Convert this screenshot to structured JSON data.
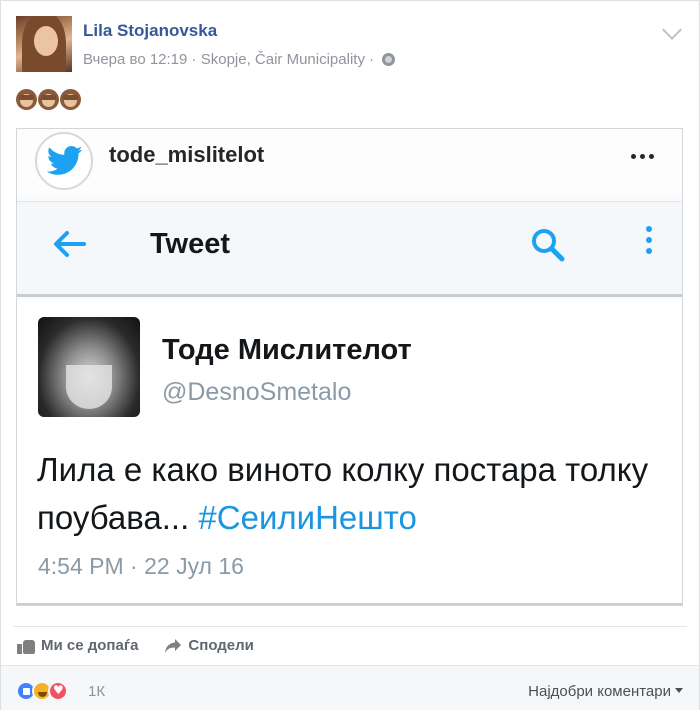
{
  "post": {
    "author": "Lila Stojanovska",
    "timestamp": "Вчера во 12:19",
    "location": "Skopje, Čair Municipality",
    "separator": " · "
  },
  "embed": {
    "instagram_user": "tode_mislitelot",
    "toolbar_title": "Tweet",
    "tweet": {
      "name": "Тоде Мислителот",
      "handle": "@DesnoSmetalo",
      "text": "Лила е како виното колку постара толку поубава...",
      "hashtag": "#СеилиНешто",
      "time": "4:54 PM · 22 Јул 16"
    }
  },
  "actions": {
    "like_label": "Ми се допаѓа",
    "share_label": "Сподели"
  },
  "reactions": {
    "count": "1К",
    "sort_label": "Најдобри коментари"
  },
  "colors": {
    "facebook_link": "#365899",
    "twitter_blue": "#1da1f2",
    "hashtag": "#1b95e0"
  },
  "icons": [
    "monkey-icon",
    "twitter-bird-icon",
    "more-icon",
    "back-arrow-icon",
    "search-icon",
    "kebab-icon",
    "like-icon",
    "share-icon",
    "globe-icon",
    "chevron-down-icon"
  ]
}
